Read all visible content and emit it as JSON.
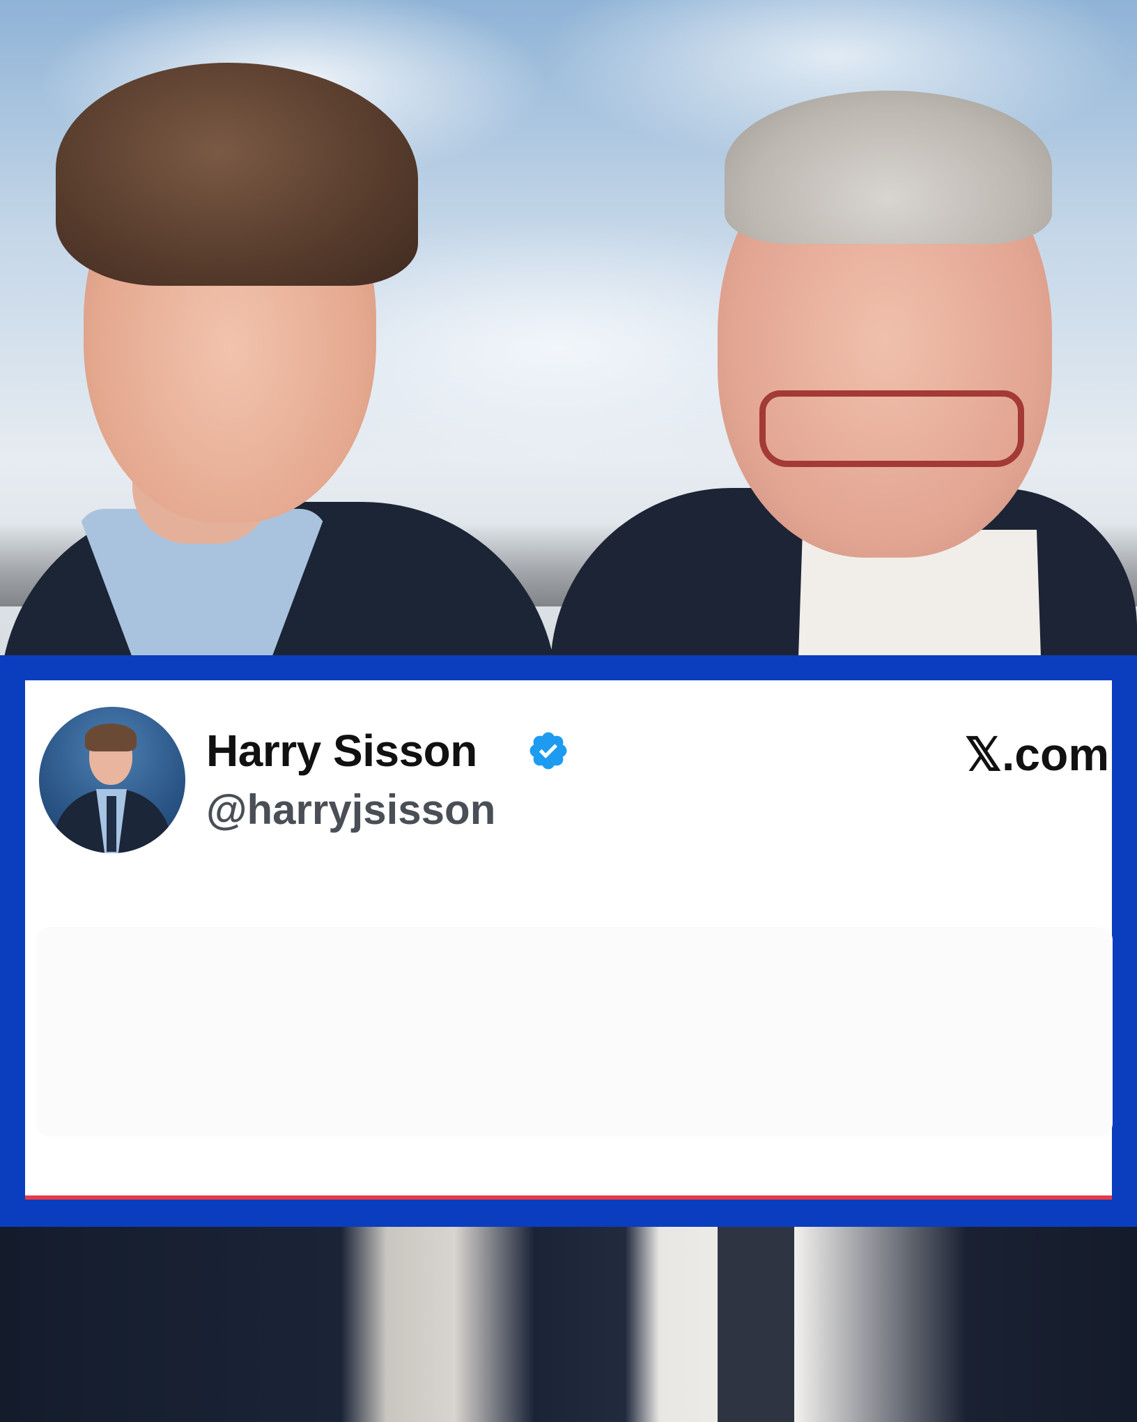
{
  "tweet_card": {
    "display_name": "Harry Sisson",
    "handle": "@harryjsisson",
    "site": "𝕏.com",
    "verified": true,
    "colors": {
      "border": "#0b3dbf",
      "verified_badge": "#1d9bf0"
    }
  },
  "icons": {
    "verified": "verified-checkmark-icon",
    "avatar": "profile-avatar"
  }
}
